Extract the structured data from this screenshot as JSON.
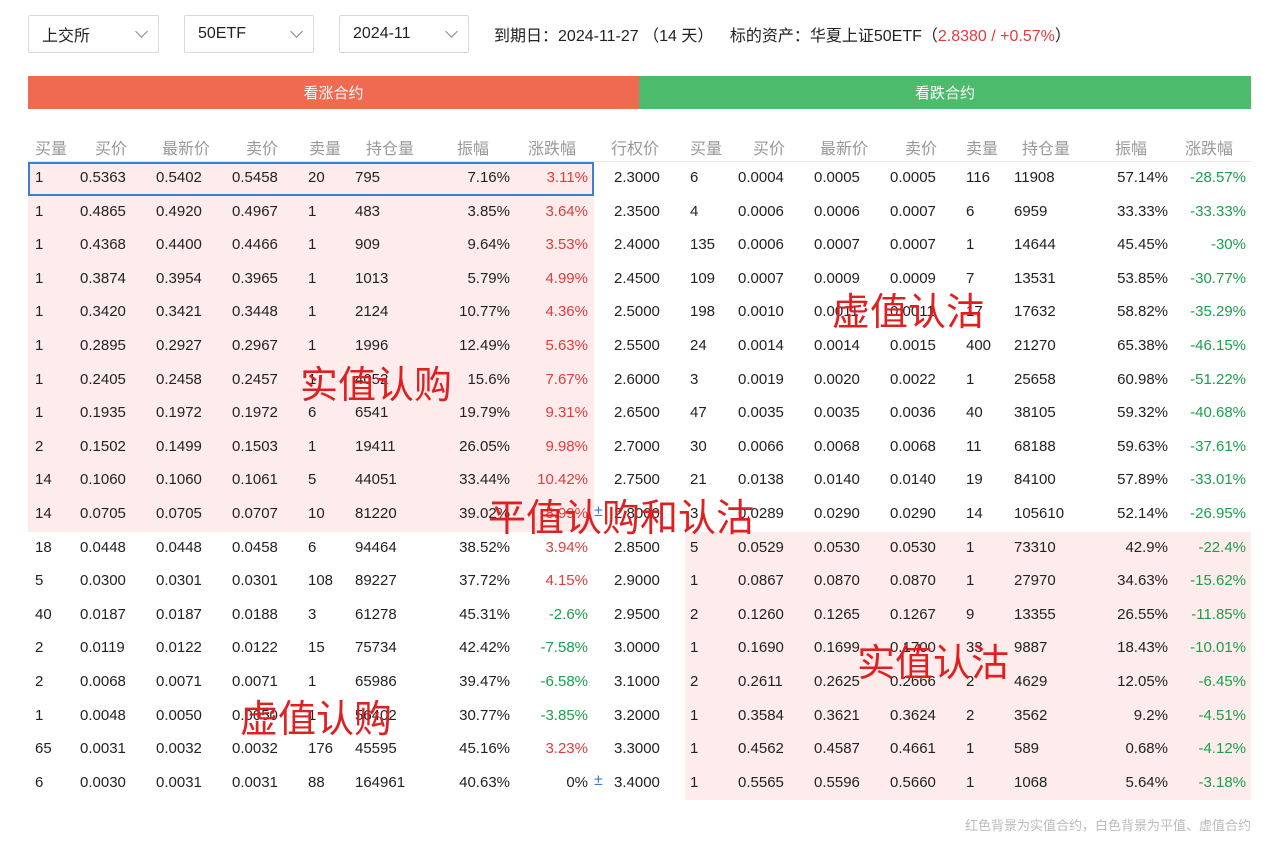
{
  "filters": {
    "exchange": "上交所",
    "product": "50ETF",
    "month": "2024-11"
  },
  "expiry": {
    "label": "到期日：",
    "date": "2024-11-27",
    "days": "（14 天）",
    "underlying_label": "标的资产：",
    "underlying_name": "华夏上证50ETF",
    "open_paren": "（",
    "price_change": "2.8380 / +0.57%",
    "close_paren": "）"
  },
  "banners": {
    "call": "看涨合约",
    "put": "看跌合约"
  },
  "columns": {
    "call": [
      "买量",
      "买价",
      "最新价",
      "卖价",
      "卖量",
      "持仓量",
      "振幅",
      "涨跌幅"
    ],
    "strike": "行权价",
    "put": [
      "买量",
      "买价",
      "最新价",
      "卖价",
      "卖量",
      "持仓量",
      "振幅",
      "涨跌幅"
    ]
  },
  "colors": {
    "call_banner": "#ef6a50",
    "put_banner": "#4cbb6c",
    "itm_bg": "#fdeceb",
    "up": "#e23b3b",
    "down": "#1a9e4b"
  },
  "rows": [
    {
      "call": [
        "1",
        "0.5363",
        "0.5402",
        "0.5458",
        "20",
        "795",
        "7.16%",
        "3.11%"
      ],
      "strike": "2.3000",
      "put": [
        "6",
        "0.0004",
        "0.0005",
        "0.0005",
        "116",
        "11908",
        "57.14%",
        "-28.57%"
      ],
      "call_itm": true,
      "put_itm": false,
      "selected": true
    },
    {
      "call": [
        "1",
        "0.4865",
        "0.4920",
        "0.4967",
        "1",
        "483",
        "3.85%",
        "3.64%"
      ],
      "strike": "2.3500",
      "put": [
        "4",
        "0.0006",
        "0.0006",
        "0.0007",
        "6",
        "6959",
        "33.33%",
        "-33.33%"
      ],
      "call_itm": true,
      "put_itm": false
    },
    {
      "call": [
        "1",
        "0.4368",
        "0.4400",
        "0.4466",
        "1",
        "909",
        "9.64%",
        "3.53%"
      ],
      "strike": "2.4000",
      "put": [
        "135",
        "0.0006",
        "0.0007",
        "0.0007",
        "1",
        "14644",
        "45.45%",
        "-30%"
      ],
      "call_itm": true,
      "put_itm": false
    },
    {
      "call": [
        "1",
        "0.3874",
        "0.3954",
        "0.3965",
        "1",
        "1013",
        "5.79%",
        "4.99%"
      ],
      "strike": "2.4500",
      "put": [
        "109",
        "0.0007",
        "0.0009",
        "0.0009",
        "7",
        "13531",
        "53.85%",
        "-30.77%"
      ],
      "call_itm": true,
      "put_itm": false
    },
    {
      "call": [
        "1",
        "0.3420",
        "0.3421",
        "0.3448",
        "1",
        "2124",
        "10.77%",
        "4.36%"
      ],
      "strike": "2.5000",
      "put": [
        "198",
        "0.0010",
        "0.0011",
        "0.0011",
        "17",
        "17632",
        "58.82%",
        "-35.29%"
      ],
      "call_itm": true,
      "put_itm": false
    },
    {
      "call": [
        "1",
        "0.2895",
        "0.2927",
        "0.2967",
        "1",
        "1996",
        "12.49%",
        "5.63%"
      ],
      "strike": "2.5500",
      "put": [
        "24",
        "0.0014",
        "0.0014",
        "0.0015",
        "400",
        "21270",
        "65.38%",
        "-46.15%"
      ],
      "call_itm": true,
      "put_itm": false
    },
    {
      "call": [
        "1",
        "0.2405",
        "0.2458",
        "0.2457",
        "1",
        "4052",
        "15.6%",
        "7.67%"
      ],
      "strike": "2.6000",
      "put": [
        "3",
        "0.0019",
        "0.0020",
        "0.0022",
        "1",
        "25658",
        "60.98%",
        "-51.22%"
      ],
      "call_itm": true,
      "put_itm": false
    },
    {
      "call": [
        "1",
        "0.1935",
        "0.1972",
        "0.1972",
        "6",
        "6541",
        "19.79%",
        "9.31%"
      ],
      "strike": "2.6500",
      "put": [
        "47",
        "0.0035",
        "0.0035",
        "0.0036",
        "40",
        "38105",
        "59.32%",
        "-40.68%"
      ],
      "call_itm": true,
      "put_itm": false
    },
    {
      "call": [
        "2",
        "0.1502",
        "0.1499",
        "0.1503",
        "1",
        "19411",
        "26.05%",
        "9.98%"
      ],
      "strike": "2.7000",
      "put": [
        "30",
        "0.0066",
        "0.0068",
        "0.0068",
        "11",
        "68188",
        "59.63%",
        "-37.61%"
      ],
      "call_itm": true,
      "put_itm": false
    },
    {
      "call": [
        "14",
        "0.1060",
        "0.1060",
        "0.1061",
        "5",
        "44051",
        "33.44%",
        "10.42%"
      ],
      "strike": "2.7500",
      "put": [
        "21",
        "0.0138",
        "0.0140",
        "0.0140",
        "19",
        "84100",
        "57.89%",
        "-33.01%"
      ],
      "call_itm": true,
      "put_itm": false
    },
    {
      "call": [
        "14",
        "0.0705",
        "0.0705",
        "0.0707",
        "10",
        "81220",
        "39.02%",
        "8.99%"
      ],
      "strike": "2.8000",
      "put": [
        "3",
        "0.0289",
        "0.0290",
        "0.0290",
        "14",
        "105610",
        "52.14%",
        "-26.95%"
      ],
      "call_itm": true,
      "put_itm": false,
      "strike_plus": "±"
    },
    {
      "call": [
        "18",
        "0.0448",
        "0.0448",
        "0.0458",
        "6",
        "94464",
        "38.52%",
        "3.94%"
      ],
      "strike": "2.8500",
      "put": [
        "5",
        "0.0529",
        "0.0530",
        "0.0530",
        "1",
        "73310",
        "42.9%",
        "-22.4%"
      ],
      "call_itm": false,
      "put_itm": true
    },
    {
      "call": [
        "5",
        "0.0300",
        "0.0301",
        "0.0301",
        "108",
        "89227",
        "37.72%",
        "4.15%"
      ],
      "strike": "2.9000",
      "put": [
        "1",
        "0.0867",
        "0.0870",
        "0.0870",
        "1",
        "27970",
        "34.63%",
        "-15.62%"
      ],
      "call_itm": false,
      "put_itm": true
    },
    {
      "call": [
        "40",
        "0.0187",
        "0.0187",
        "0.0188",
        "3",
        "61278",
        "45.31%",
        "-2.6%"
      ],
      "strike": "2.9500",
      "put": [
        "2",
        "0.1260",
        "0.1265",
        "0.1267",
        "9",
        "13355",
        "26.55%",
        "-11.85%"
      ],
      "call_itm": false,
      "put_itm": true
    },
    {
      "call": [
        "2",
        "0.0119",
        "0.0122",
        "0.0122",
        "15",
        "75734",
        "42.42%",
        "-7.58%"
      ],
      "strike": "3.0000",
      "put": [
        "1",
        "0.1690",
        "0.1699",
        "0.1700",
        "33",
        "9887",
        "18.43%",
        "-10.01%"
      ],
      "call_itm": false,
      "put_itm": true
    },
    {
      "call": [
        "2",
        "0.0068",
        "0.0071",
        "0.0071",
        "1",
        "65986",
        "39.47%",
        "-6.58%"
      ],
      "strike": "3.1000",
      "put": [
        "2",
        "0.2611",
        "0.2625",
        "0.2666",
        "2",
        "4629",
        "12.05%",
        "-6.45%"
      ],
      "call_itm": false,
      "put_itm": true
    },
    {
      "call": [
        "1",
        "0.0048",
        "0.0050",
        "0.0050",
        "1",
        "56402",
        "30.77%",
        "-3.85%"
      ],
      "strike": "3.2000",
      "put": [
        "1",
        "0.3584",
        "0.3621",
        "0.3624",
        "2",
        "3562",
        "9.2%",
        "-4.51%"
      ],
      "call_itm": false,
      "put_itm": true
    },
    {
      "call": [
        "65",
        "0.0031",
        "0.0032",
        "0.0032",
        "176",
        "45595",
        "45.16%",
        "3.23%"
      ],
      "strike": "3.3000",
      "put": [
        "1",
        "0.4562",
        "0.4587",
        "0.4661",
        "1",
        "589",
        "0.68%",
        "-4.12%"
      ],
      "call_itm": false,
      "put_itm": true
    },
    {
      "call": [
        "6",
        "0.0030",
        "0.0031",
        "0.0031",
        "88",
        "164961",
        "40.63%",
        "0%"
      ],
      "strike": "3.4000",
      "put": [
        "1",
        "0.5565",
        "0.5596",
        "0.5660",
        "1",
        "1068",
        "5.64%",
        "-3.18%"
      ],
      "call_itm": false,
      "put_itm": true,
      "strike_plus": "±"
    }
  ],
  "annotations": {
    "itm_call": "实值认购",
    "otm_put": "虚值认沽",
    "atm": "平值认购和认沽",
    "itm_put": "实值认沽",
    "otm_call": "虚值认购"
  },
  "footnote": "红色背景为实值合约，白色背景为平值、虚值合约"
}
